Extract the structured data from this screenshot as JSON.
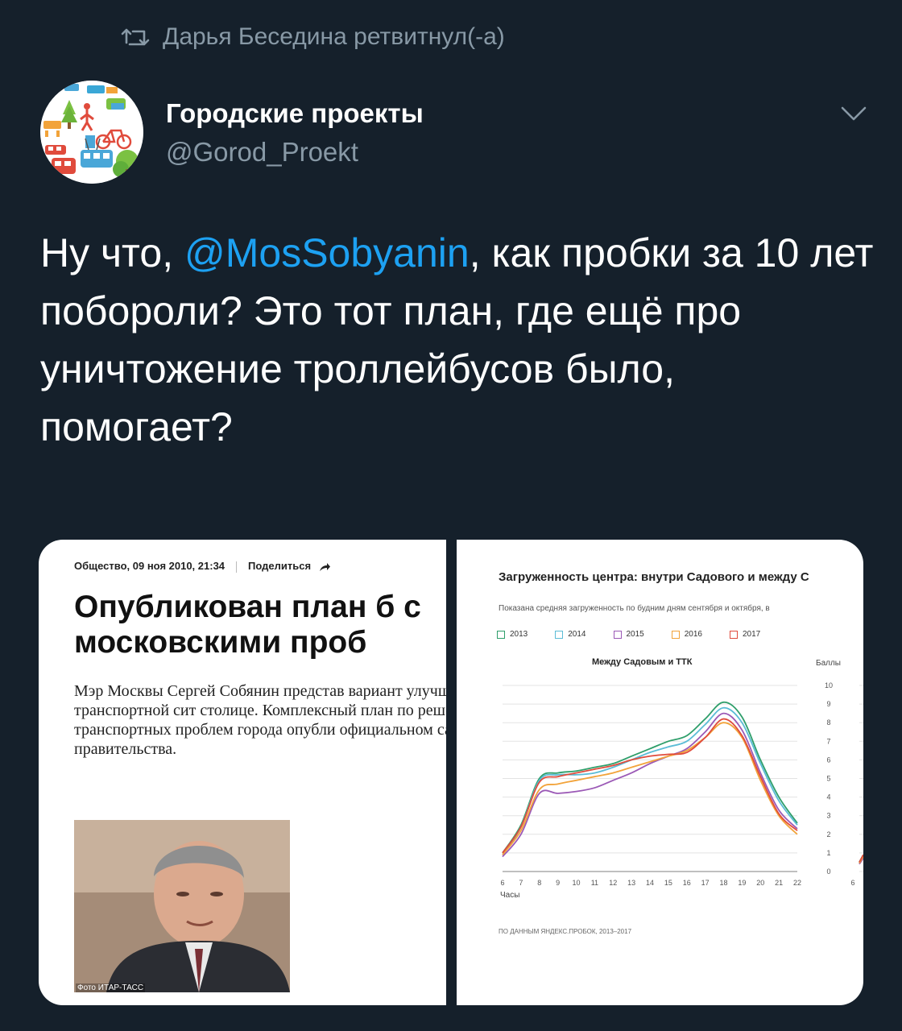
{
  "retweet": {
    "text": "Дарья Беседина ретвитнул(-а)",
    "icon": "retweet-icon"
  },
  "author": {
    "name": "Городские проекты",
    "handle": "@Gorod_Proekt"
  },
  "tweet": {
    "before": "Ну что, ",
    "mention": "@MosSobyanin",
    "after": ", как пробки за 10 лет побороли? Это тот план, где ещё про уничтожение троллейбусов было, помогает?"
  },
  "colors": {
    "background": "#15202b",
    "secondary_text": "#8899a6",
    "mention": "#1da1f2"
  },
  "article": {
    "meta": "Общество, 09 ноя 2010, 21:34",
    "share": "Поделиться",
    "headline": "Опубликован план б с московскими проб",
    "lead": "Мэр Москвы Сергей Собянин представ вариант улучшения транспортной сит столице. Комплексный план по решени транспортных проблем города опубли официальном сайте правительства.",
    "photo_credit": "Фото ИТАР-ТАСС"
  },
  "chart_data": {
    "type": "line",
    "title": "Загруженность центра: внутри Садового и между С",
    "subtitle": "Показана средняя загруженность по будним дням сентября и октября, в",
    "panel_title": "Между Садовым и ТТК",
    "xlabel": "Часы",
    "ylabel": "Баллы",
    "x": [
      6,
      7,
      8,
      9,
      10,
      11,
      12,
      13,
      14,
      15,
      16,
      17,
      18,
      19,
      20,
      21,
      22
    ],
    "x_ticks": [
      "6",
      "7",
      "8",
      "9",
      "10",
      "11",
      "12",
      "13",
      "14",
      "15",
      "16",
      "17",
      "18",
      "19",
      "20",
      "21",
      "22"
    ],
    "y_ticks": [
      "0",
      "1",
      "2",
      "3",
      "4",
      "5",
      "6",
      "7",
      "8",
      "9",
      "10"
    ],
    "ylim": [
      0,
      10
    ],
    "grid": true,
    "next_panel_tick": "6",
    "source": "ПО ДАННЫМ ЯНДЕКС.ПРОБОК, 2013–2017",
    "series": [
      {
        "name": "2013",
        "color": "#2e9e6a",
        "values": [
          1.0,
          2.5,
          5.0,
          5.3,
          5.4,
          5.6,
          5.8,
          6.2,
          6.6,
          7.0,
          7.3,
          8.2,
          9.1,
          8.3,
          6.0,
          4.0,
          2.6
        ]
      },
      {
        "name": "2014",
        "color": "#5bbcd6",
        "values": [
          0.9,
          2.4,
          4.9,
          5.2,
          5.2,
          5.3,
          5.6,
          6.0,
          6.4,
          6.7,
          7.0,
          7.9,
          8.8,
          8.0,
          5.8,
          3.8,
          2.5
        ]
      },
      {
        "name": "2015",
        "color": "#9b59b6",
        "values": [
          0.8,
          2.0,
          4.2,
          4.2,
          4.3,
          4.5,
          4.9,
          5.3,
          5.8,
          6.2,
          6.6,
          7.5,
          8.5,
          7.6,
          5.3,
          3.3,
          2.3
        ]
      },
      {
        "name": "2016",
        "color": "#f2a33a",
        "values": [
          0.9,
          2.2,
          4.4,
          4.7,
          4.9,
          5.1,
          5.3,
          5.6,
          5.9,
          6.2,
          6.5,
          7.2,
          8.0,
          7.2,
          4.9,
          3.0,
          2.0
        ]
      },
      {
        "name": "2017",
        "color": "#e04b3c",
        "values": [
          1.0,
          2.4,
          4.8,
          5.1,
          5.3,
          5.5,
          5.7,
          6.0,
          6.2,
          6.3,
          6.4,
          7.2,
          8.2,
          7.3,
          5.1,
          3.1,
          2.2
        ]
      }
    ]
  }
}
